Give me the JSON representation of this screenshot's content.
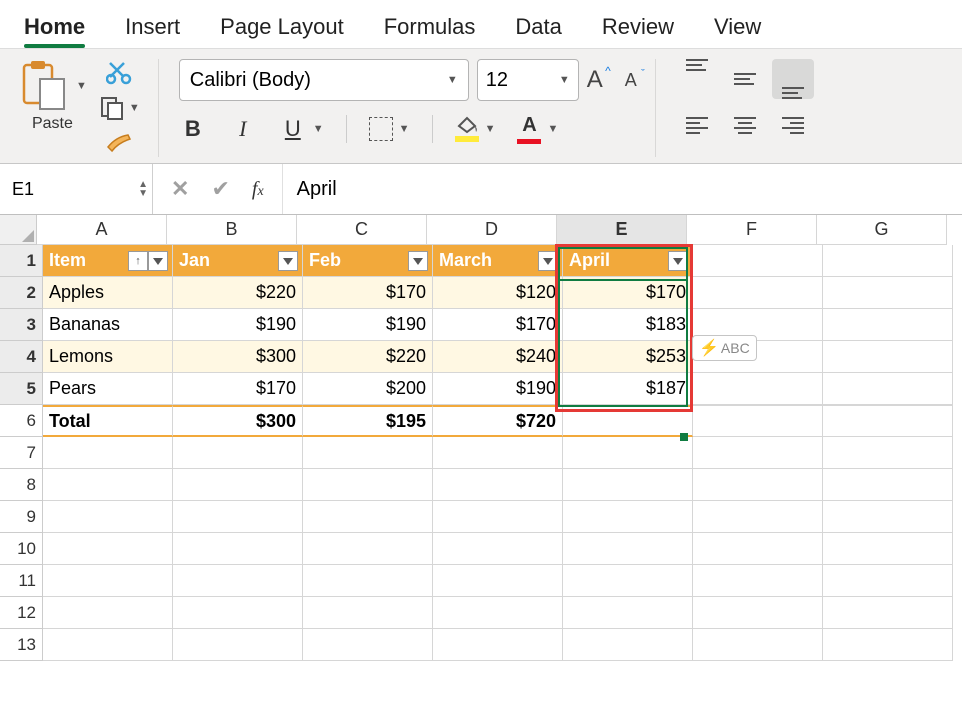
{
  "tabs": [
    "Home",
    "Insert",
    "Page Layout",
    "Formulas",
    "Data",
    "Review",
    "View"
  ],
  "active_tab": "Home",
  "ribbon": {
    "paste_label": "Paste",
    "font_name": "Calibri (Body)",
    "font_size": "12"
  },
  "name_box": "E1",
  "formula_value": "April",
  "columns": [
    "A",
    "B",
    "C",
    "D",
    "E",
    "F",
    "G"
  ],
  "selected_col": "E",
  "selected_rows": [
    1,
    2,
    3,
    4,
    5
  ],
  "table": {
    "headers": [
      "Item",
      "Jan",
      "Feb",
      "March",
      "April"
    ],
    "rows": [
      {
        "item": "Apples",
        "jan": "$220",
        "feb": "$170",
        "march": "$120",
        "april": "$170"
      },
      {
        "item": "Bananas",
        "jan": "$190",
        "feb": "$190",
        "march": "$170",
        "april": "$183"
      },
      {
        "item": "Lemons",
        "jan": "$300",
        "feb": "$220",
        "march": "$240",
        "april": "$253"
      },
      {
        "item": "Pears",
        "jan": "$170",
        "feb": "$200",
        "march": "$190",
        "april": "$187"
      }
    ],
    "total": {
      "label": "Total",
      "jan": "$300",
      "feb": "$195",
      "march": "$720",
      "april": ""
    }
  },
  "flash_fill_tag": "ABC",
  "chart_data": {
    "type": "table",
    "columns": [
      "Item",
      "Jan",
      "Feb",
      "March",
      "April"
    ],
    "rows": [
      [
        "Apples",
        220,
        170,
        120,
        170
      ],
      [
        "Bananas",
        190,
        190,
        170,
        183
      ],
      [
        "Lemons",
        300,
        220,
        240,
        253
      ],
      [
        "Pears",
        170,
        200,
        190,
        187
      ],
      [
        "Total",
        300,
        195,
        720,
        null
      ]
    ]
  }
}
